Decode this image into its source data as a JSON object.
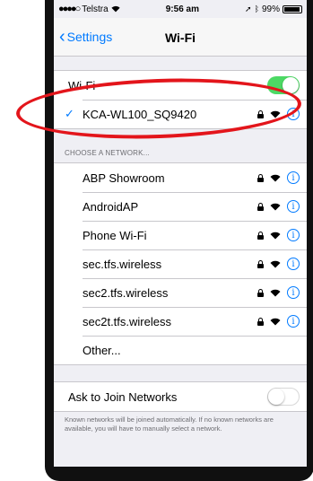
{
  "status_bar": {
    "carrier": "Telstra",
    "time": "9:56 am",
    "battery": "99%"
  },
  "nav": {
    "back_label": "Settings",
    "title": "Wi-Fi"
  },
  "wifi": {
    "label": "Wi-Fi",
    "enabled": true,
    "connected_network": "KCA-WL100_SQ9420"
  },
  "choose_header": "CHOOSE A NETWORK...",
  "networks": [
    {
      "name": "ABP Showroom"
    },
    {
      "name": "AndroidAP"
    },
    {
      "name": "Phone Wi-Fi"
    },
    {
      "name": "sec.tfs.wireless"
    },
    {
      "name": "sec2.tfs.wireless"
    },
    {
      "name": "sec2t.tfs.wireless"
    }
  ],
  "other_label": "Other...",
  "ask_to_join": {
    "label": "Ask to Join Networks",
    "enabled": false,
    "note": "Known networks will be joined automatically. If no known networks are available, you will have to manually select a network."
  },
  "colors": {
    "accent": "#007aff",
    "toggle_on": "#4cd964",
    "highlight_oval": "#e3151b"
  },
  "icons": {
    "lock": "lock-icon",
    "wifi": "wifi-icon",
    "info": "info-icon"
  }
}
